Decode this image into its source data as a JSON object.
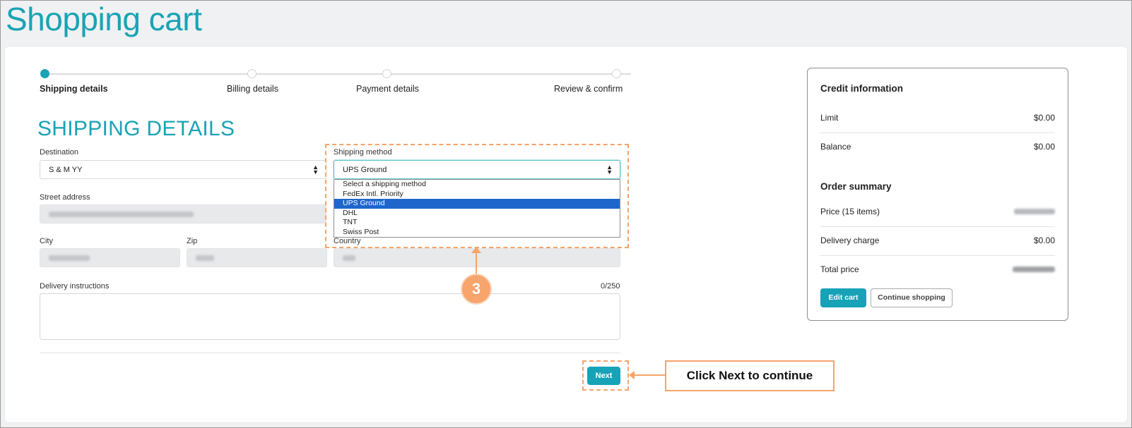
{
  "page": {
    "title": "Shopping cart"
  },
  "stepper": {
    "steps": [
      {
        "label": "Shipping details",
        "active": true
      },
      {
        "label": "Billing details",
        "active": false
      },
      {
        "label": "Payment details",
        "active": false
      },
      {
        "label": "Review & confirm",
        "active": false
      }
    ]
  },
  "form": {
    "section_title": "SHIPPING DETAILS",
    "destination": {
      "label": "Destination",
      "value": "S & M YY"
    },
    "shipping_method": {
      "label": "Shipping method",
      "value": "UPS Ground",
      "options": [
        "Select a shipping method",
        "FedEx Intl. Priority",
        "UPS Ground",
        "DHL",
        "TNT",
        "Swiss Post"
      ],
      "selected_index": 2
    },
    "street": {
      "label": "Street address"
    },
    "city": {
      "label": "City"
    },
    "zip": {
      "label": "Zip"
    },
    "country": {
      "label": "Country"
    },
    "delivery": {
      "label": "Delivery instructions",
      "counter": "0/250"
    },
    "next_label": "Next"
  },
  "annotations": {
    "step_number": "3",
    "tip": "Click Next to continue",
    "accent_color": "#f5a46a"
  },
  "sidebar": {
    "credit_title": "Credit information",
    "limit": {
      "label": "Limit",
      "value": "$0.00"
    },
    "balance": {
      "label": "Balance",
      "value": "$0.00"
    },
    "order_title": "Order summary",
    "price": {
      "label": "Price (15 items)"
    },
    "delivery": {
      "label": "Delivery charge",
      "value": "$0.00"
    },
    "total": {
      "label": "Total price"
    },
    "edit_cart": "Edit cart",
    "continue_shopping": "Continue shopping"
  },
  "colors": {
    "brand": "#1aa3b4",
    "button": "#17a2b8",
    "selected_option": "#1e66cc"
  }
}
